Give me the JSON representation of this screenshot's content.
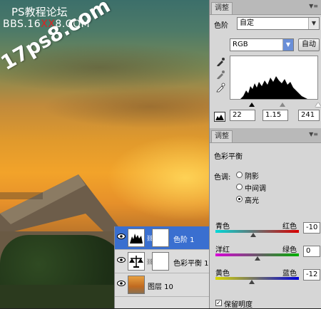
{
  "watermark": {
    "title": "PS教程论坛",
    "bbs_prefix": "BBS.16",
    "bbs_red": "XX",
    "bbs_suffix": "8.COM",
    "site": "17ps8.com"
  },
  "layers": [
    {
      "name": "色阶 1",
      "selected": true
    },
    {
      "name": "色彩平衡 1",
      "selected": false
    },
    {
      "name": "图层 10",
      "selected": false
    }
  ],
  "levels_panel": {
    "tab": "调整",
    "preset_label": "色阶",
    "preset_value": "自定",
    "channel": "RGB",
    "auto_button": "自动",
    "input_black": "22",
    "input_gamma": "1.15",
    "input_white": "241"
  },
  "color_balance_panel": {
    "tab": "调整",
    "title": "色彩平衡",
    "tone_label": "色调:",
    "tones": [
      {
        "label": "阴影",
        "selected": false
      },
      {
        "label": "中间调",
        "selected": false
      },
      {
        "label": "高光",
        "selected": true
      }
    ],
    "sliders": [
      {
        "left": "青色",
        "right": "红色",
        "value": "-10",
        "level": -10
      },
      {
        "left": "洋红",
        "right": "绿色",
        "value": "0",
        "level": 0
      },
      {
        "left": "黄色",
        "right": "蓝色",
        "value": "-12",
        "level": -12
      }
    ],
    "preserve_luminosity": "保留明度"
  },
  "colors": {
    "selection": "#3a6fd0",
    "panel_bg": "#d6d6d6",
    "watermark_red": "#e02020"
  },
  "icons": [
    "eye-icon",
    "levels-icon",
    "color-balance-icon",
    "eyedropper-icon",
    "chain-icon",
    "menu-icon"
  ]
}
